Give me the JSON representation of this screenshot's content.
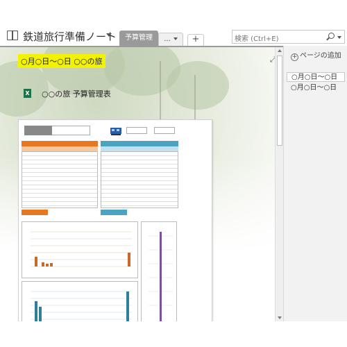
{
  "notebook": {
    "title": "鉄道旅行準備ノート"
  },
  "tabs": [
    {
      "label": "予算管理",
      "active": true
    },
    {
      "label": "...",
      "active": false
    },
    {
      "label": "+",
      "active": false
    }
  ],
  "search": {
    "placeholder": "検索 (Ctrl+E)"
  },
  "page": {
    "title": "○月○日～○日 ○○の旅",
    "attachment_label": "○○の旅 予算管理表",
    "attachment_icon": "excel-file-icon",
    "expand_icon": "expand-icon"
  },
  "pagelist": {
    "add_label": "ページの追加",
    "items": [
      {
        "label": "○月○日～○日",
        "selected": true
      },
      {
        "label": "○月○日～○日",
        "selected": false
      }
    ]
  },
  "colors": {
    "title_highlight": "#f3f300",
    "tab_active": "#9a9a9a",
    "sheet_orange": "#e87722",
    "sheet_teal": "#4aa3c0",
    "excel_green": "#1e7145"
  }
}
